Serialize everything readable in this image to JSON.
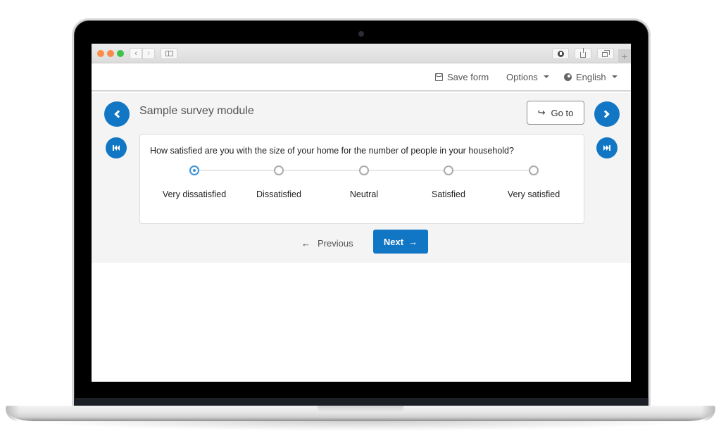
{
  "browser": {
    "back_icon": "‹",
    "forward_icon": "›",
    "new_tab_icon": "+"
  },
  "topnav": {
    "save_label": "Save form",
    "options_label": "Options",
    "language_label": "English"
  },
  "module": {
    "title": "Sample survey module",
    "goto_label": "Go to",
    "goto_icon": "↪"
  },
  "question": {
    "text": "How satisfied are you with the size of your home for the number of people in your household?",
    "options": [
      {
        "label": "Very dissatisfied",
        "selected": true
      },
      {
        "label": "Dissatisfied",
        "selected": false
      },
      {
        "label": "Neutral",
        "selected": false
      },
      {
        "label": "Satisfied",
        "selected": false
      },
      {
        "label": "Very satisfied",
        "selected": false
      }
    ]
  },
  "navigation": {
    "previous_label": "Previous",
    "previous_icon": "←",
    "next_label": "Next",
    "next_icon": "→"
  },
  "colors": {
    "accent": "#1176c4",
    "selected_radio": "#3a92d8",
    "panel_bg": "#f4f4f4"
  }
}
